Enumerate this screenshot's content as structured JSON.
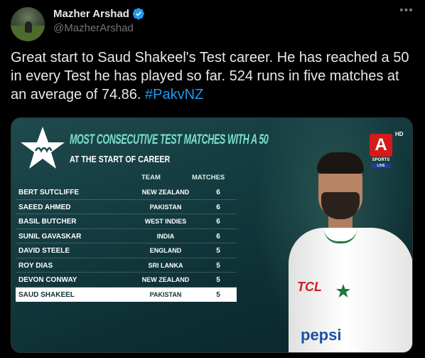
{
  "author": {
    "name": "Mazher Arshad",
    "handle": "@MazherArshad"
  },
  "tweet": {
    "text": "Great start to Saud Shakeel's Test career. He has reached a 50 in every Test he has played so far. 524 runs in five matches at an average of 74.86. ",
    "hashtag": "#PakvNZ"
  },
  "graphic": {
    "title": "MOST CONSECUTIVE TEST MATCHES WITH A 50",
    "subtitle": "AT THE START OF CAREER",
    "col_team": "TEAM",
    "col_matches": "MATCHES",
    "rows": [
      {
        "name": "BERT SUTCLIFFE",
        "team": "NEW ZEALAND",
        "matches": "6"
      },
      {
        "name": "SAEED AHMED",
        "team": "PAKISTAN",
        "matches": "6"
      },
      {
        "name": "BASIL BUTCHER",
        "team": "WEST INDIES",
        "matches": "6"
      },
      {
        "name": "SUNIL GAVASKAR",
        "team": "INDIA",
        "matches": "6"
      },
      {
        "name": "DAVID STEELE",
        "team": "ENGLAND",
        "matches": "5"
      },
      {
        "name": "ROY DIAS",
        "team": "SRI LANKA",
        "matches": "5"
      },
      {
        "name": "DEVON CONWAY",
        "team": "NEW ZEALAND",
        "matches": "5"
      },
      {
        "name": "SAUD SHAKEEL",
        "team": "PAKISTAN",
        "matches": "5"
      }
    ],
    "channel": {
      "letter": "A",
      "hd": "HD",
      "sports": "SPORTS",
      "live": "LIVE"
    },
    "shirt_sponsor_1": "TCL",
    "shirt_sponsor_2": "pepsi"
  },
  "colors": {
    "hashtag": "#1d9bf0",
    "verified": "#1d9bf0",
    "title_accent": "#7be0c9",
    "channel_red": "#d51a1a"
  },
  "icons": [
    "verified-badge-icon",
    "more-options-icon",
    "pakistan-star-logo-icon",
    "pakistan-crest-icon"
  ]
}
